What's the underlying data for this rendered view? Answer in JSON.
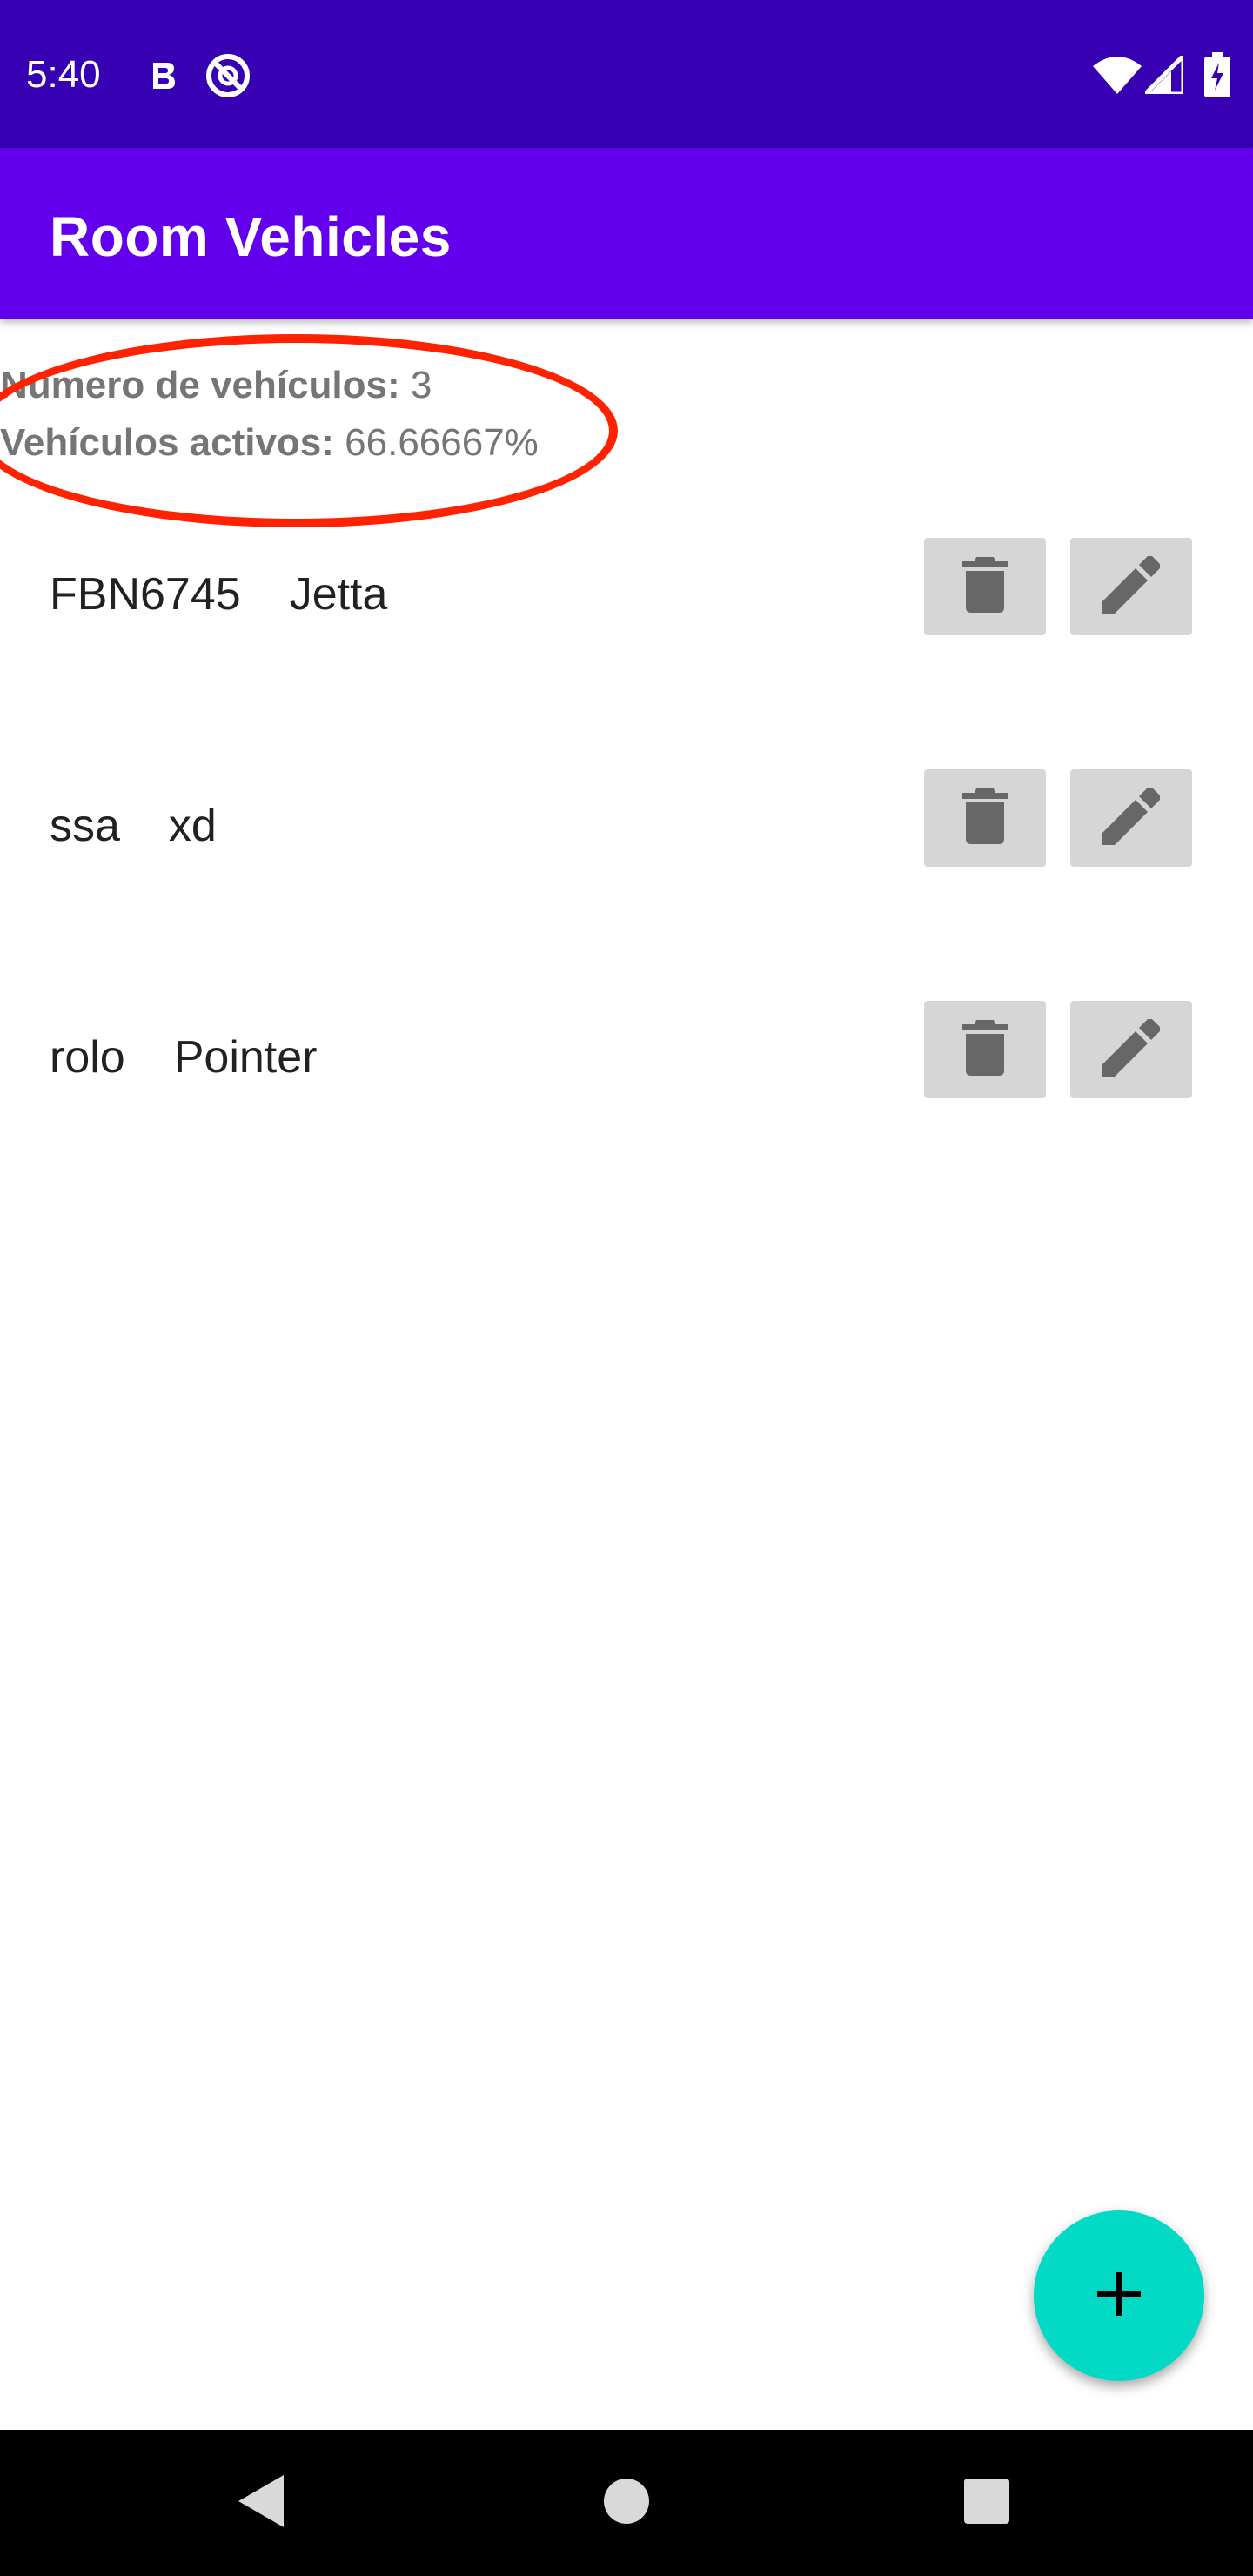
{
  "status_bar": {
    "time": "5:40",
    "icons": [
      "b-notification-icon",
      "do-not-disturb-icon",
      "wifi-icon",
      "signal-icon",
      "battery-charging-icon"
    ]
  },
  "app_bar": {
    "title": "Room Vehicles"
  },
  "summary": {
    "count_label": "Numero de vehículos:",
    "count_value": " 3",
    "active_label": "Vehículos activos:",
    "active_value": " 66.66667%"
  },
  "vehicles": [
    {
      "plate": "FBN6745",
      "model": "Jetta"
    },
    {
      "plate": "ssa",
      "model": "xd"
    },
    {
      "plate": "rolo",
      "model": "Pointer"
    }
  ],
  "fab": {
    "icon": "plus-icon"
  },
  "colors": {
    "status_bar": "#3700b3",
    "app_bar": "#6200ee",
    "fab": "#03dac5",
    "row_button": "#d6d6d6",
    "highlight": "#ff2200"
  }
}
